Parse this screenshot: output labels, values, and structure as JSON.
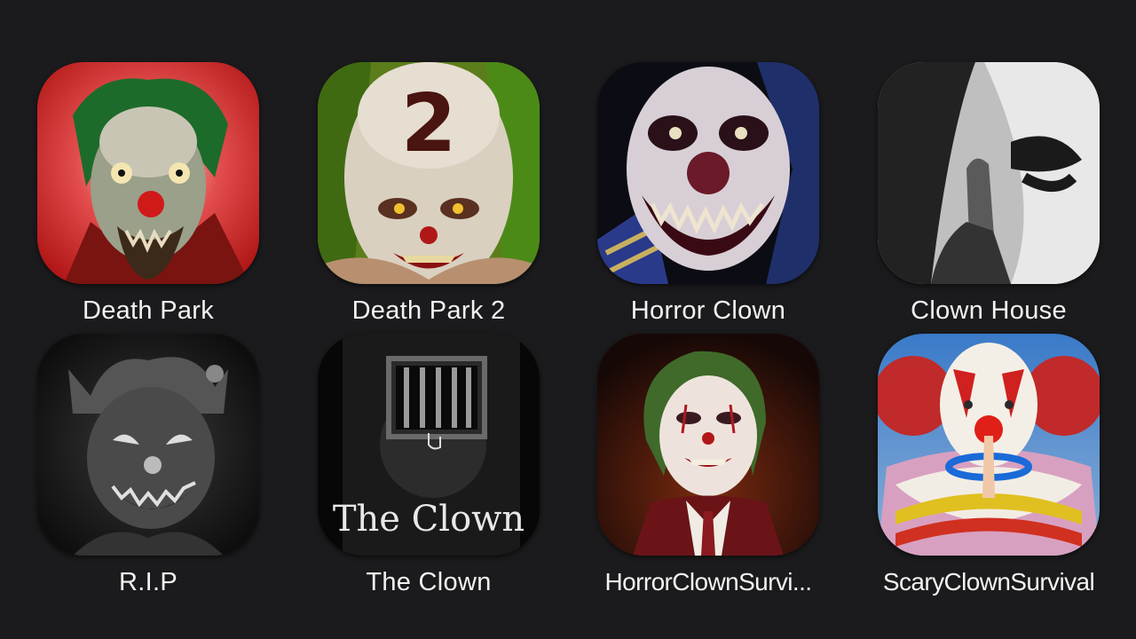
{
  "apps": [
    {
      "label": "Death Park",
      "icon": "death-park-clown-icon"
    },
    {
      "label": "Death Park 2",
      "icon": "death-park-2-clown-icon",
      "icon_text": "2"
    },
    {
      "label": "Horror Clown",
      "icon": "horror-clown-icon"
    },
    {
      "label": "Clown House",
      "icon": "clown-house-shush-icon"
    },
    {
      "label": "R.I.P",
      "icon": "rip-jester-icon"
    },
    {
      "label": "The Clown",
      "icon": "the-clown-door-icon",
      "icon_text": "The Clown"
    },
    {
      "label": "HorrorClownSurvi...",
      "icon": "horror-clown-survival-icon"
    },
    {
      "label": "ScaryClownSurvival",
      "icon": "scary-clown-survival-icon"
    }
  ],
  "colors": {
    "background": "#1b1b1d",
    "label": "#f2f2f2"
  }
}
